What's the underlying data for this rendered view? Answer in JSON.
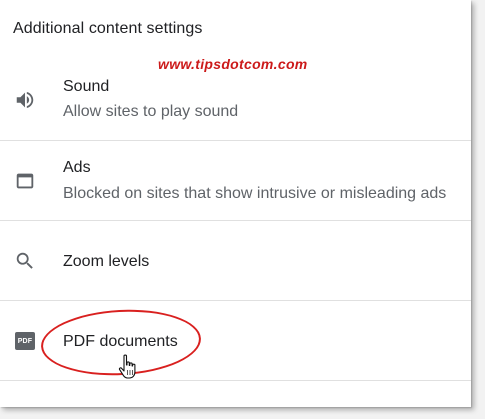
{
  "header": {
    "title": "Additional content settings"
  },
  "watermark": {
    "text": "www.tipsdotcom.com"
  },
  "rows": [
    {
      "title": "Sound",
      "subtitle": "Allow sites to play sound",
      "icon": "speaker-icon"
    },
    {
      "title": "Ads",
      "subtitle": "Blocked on sites that show intrusive or misleading ads",
      "icon": "window-icon"
    },
    {
      "title": "Zoom levels",
      "icon": "search-icon"
    },
    {
      "title": "PDF documents",
      "icon": "pdf-icon",
      "icon_text": "PDF"
    }
  ],
  "annotation": {
    "highlight_color": "#d9201f",
    "cursor": "hand-pointer"
  },
  "colors": {
    "primary_text": "#202124",
    "secondary_text": "#5f6368",
    "watermark": "#cc1a1a",
    "divider": "#e0e0e0"
  }
}
